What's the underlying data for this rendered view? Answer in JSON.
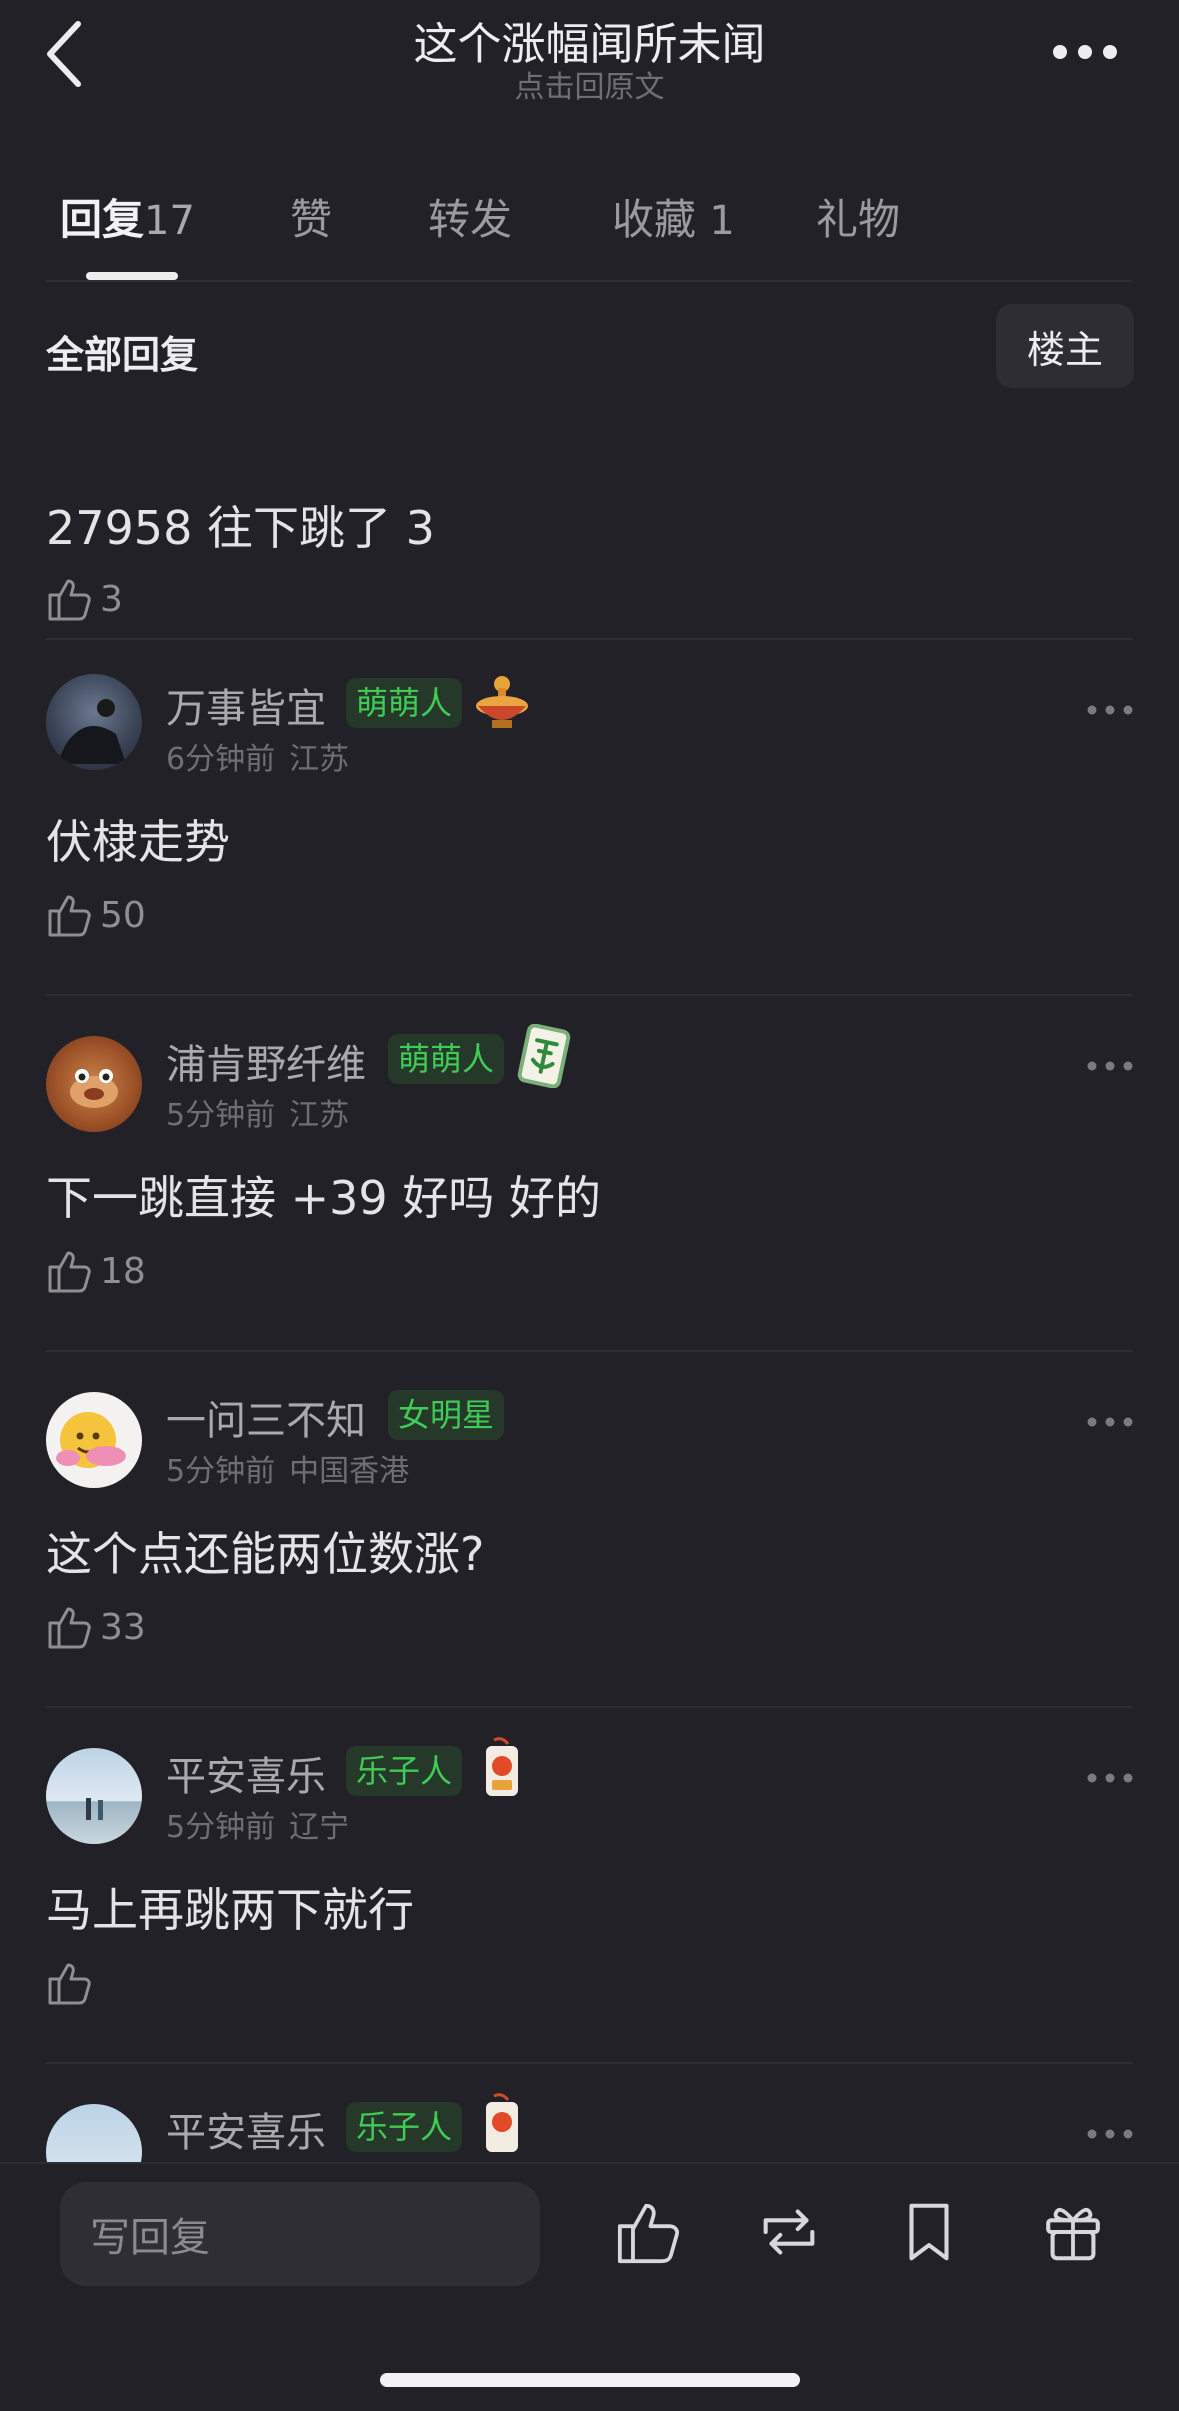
{
  "header": {
    "title": "这个涨幅闻所未闻",
    "subtitle": "点击回原文"
  },
  "tabs": [
    {
      "label": "回复",
      "count": "17",
      "active": true
    },
    {
      "label": "赞",
      "count": ""
    },
    {
      "label": "转发",
      "count": ""
    },
    {
      "label": "收藏",
      "count": "1"
    },
    {
      "label": "礼物",
      "count": ""
    }
  ],
  "filter": {
    "all_replies": "全部回复",
    "op_button": "楼主"
  },
  "comments": [
    {
      "name": "",
      "badge": "",
      "time": "",
      "location": "",
      "text": "27958  往下跳了 3",
      "likes": "3"
    },
    {
      "name": "万事皆宜",
      "badge": "萌萌人",
      "decoration": "hotpot-icon",
      "time": "6分钟前",
      "location": "江苏",
      "text": "伏棣走势",
      "likes": "50"
    },
    {
      "name": "浦肯野纤维",
      "badge": "萌萌人",
      "decoration": "mahjong-fa-tile-icon",
      "time": "5分钟前",
      "location": "江苏",
      "text": "下一跳直接 +39 好吗 好的",
      "likes": "18"
    },
    {
      "name": "一问三不知",
      "badge": "女明星",
      "decoration": "",
      "time": "5分钟前",
      "location": "中国香港",
      "text": "这个点还能两位数涨?",
      "likes": "33"
    },
    {
      "name": "平安喜乐",
      "badge": "乐子人",
      "decoration": "lucky-charm-icon",
      "time": "5分钟前",
      "location": "辽宁",
      "text": "马上再跳两下就行",
      "likes": ""
    },
    {
      "name": "平安喜乐",
      "badge": "乐子人",
      "decoration": "lucky-charm-icon",
      "time": "",
      "location": "",
      "text": "",
      "likes": ""
    }
  ],
  "bottom_bar": {
    "reply_placeholder": "写回复",
    "icons": [
      "like-icon",
      "repost-icon",
      "bookmark-icon",
      "gift-icon"
    ]
  },
  "colors": {
    "background": "#222127",
    "badge_text": "#3FCB55",
    "badge_bg": "#25382A"
  }
}
